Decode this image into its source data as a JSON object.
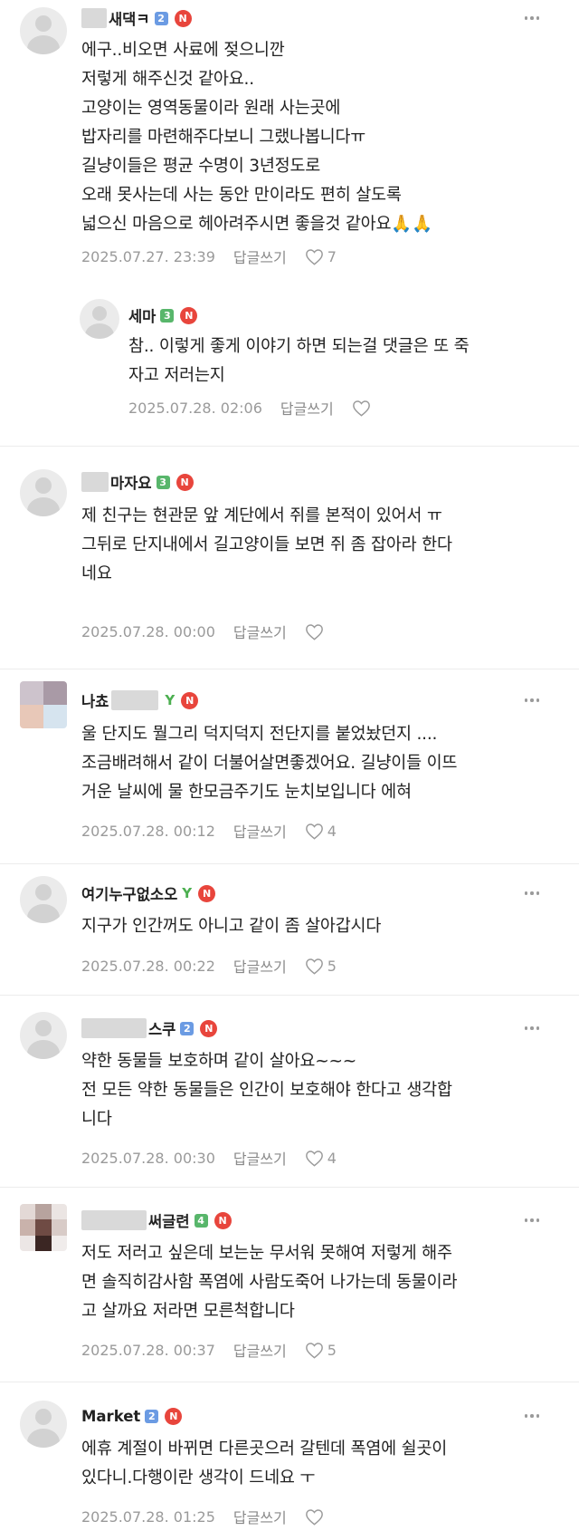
{
  "comments": [
    {
      "nick": "새댁ㅋ",
      "badge": "2",
      "text": "에구..비오면 사료에 젖으니깐\n저렇게 해주신것 같아요..\n고양이는 영역동물이라 원래 사는곳에\n밥자리를 마련해주다보니 그랬나봅니다ㅠ\n길냥이들은 평균 수명이 3년정도로\n오래 못사는데 사는 동안 만이라도 편히 살도록\n넓으신 마음으로 헤아려주시면 좋을것 같아요🙏🙏",
      "date": "2025.07.27. 23:39",
      "reply": "답글쓰기",
      "likes": "7"
    },
    {
      "nick": "세마",
      "badge": "3",
      "text": "참.. 이렇게 좋게 이야기 하면 되는걸 댓글은 또 죽\n자고 저러는지",
      "date": "2025.07.28. 02:06",
      "reply": "답글쓰기",
      "likes": ""
    },
    {
      "nick": "마자요",
      "badge": "3",
      "text": "제 친구는 현관문 앞 계단에서 쥐를 본적이 있어서 ㅠ\n그뒤로 단지내에서 길고양이들 보면 쥐 좀 잡아라 한다\n네요",
      "date": "2025.07.28. 00:00",
      "reply": "답글쓰기",
      "likes": ""
    },
    {
      "nick": "나쵸",
      "badge": "sprout",
      "text": "울 단지도 뭘그리 덕지덕지 전단지를 붙었놨던지 ....\n조금배려해서 같이 더불어살면좋겠어요. 길냥이들 이뜨\n거운 날씨에 물 한모금주기도 눈치보입니다 에혀",
      "date": "2025.07.28. 00:12",
      "reply": "답글쓰기",
      "likes": "4"
    },
    {
      "nick": "여기누구없소오",
      "badge": "sprout",
      "text": "지구가 인간꺼도 아니고 같이 좀 살아갑시다",
      "date": "2025.07.28. 00:22",
      "reply": "답글쓰기",
      "likes": "5"
    },
    {
      "nick": "스쿠",
      "badge": "2",
      "text": "약한 동물들 보호하며 같이 살아요~~~\n전 모든 약한 동물들은 인간이 보호해야 한다고 생각합\n니다",
      "date": "2025.07.28. 00:30",
      "reply": "답글쓰기",
      "likes": "4"
    },
    {
      "nick": "써글련",
      "badge": "4",
      "text": "저도 저러고 싶은데 보는눈 무서워 못해여 저렇게 해주\n면 솔직히감사함 폭염에 사람도죽어 나가는데 동물이라\n고 살까요 저라면 모른척합니다",
      "date": "2025.07.28. 00:37",
      "reply": "답글쓰기",
      "likes": "5"
    },
    {
      "nick": "Market",
      "badge": "2",
      "text": "에휴 계절이 바뀌면 다른곳으러 갈텐데 폭염에 쉴곳이\n있다니.다행이란 생각이 드네요 ㅜ",
      "date": "2025.07.28. 01:25",
      "reply": "답글쓰기",
      "likes": ""
    }
  ],
  "new_badge": "N",
  "colors": {
    "text": "#222222",
    "meta": "#9a9a9a",
    "new_badge": "#e8453c",
    "level_blue": "#6b9be3",
    "level_green": "#58b66b",
    "sprout": "#4caf50"
  }
}
